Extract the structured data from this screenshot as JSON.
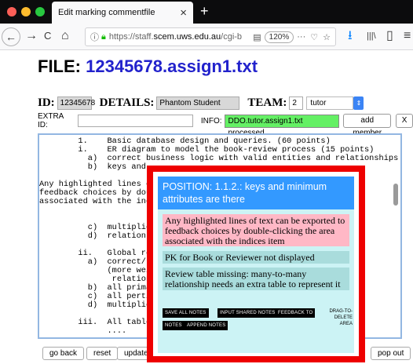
{
  "browser": {
    "tab_title": "Edit marking commentfile",
    "tab_close": "×",
    "new_tab": "+",
    "url_scheme": "https://staff.",
    "url_host": "scem.uws.edu.au",
    "url_rest": "/cgi-b",
    "zoom": "120%",
    "more_icon": "···",
    "nav": {
      "back": "←",
      "forward": "→",
      "reload": "C",
      "home": "⌂"
    },
    "toolbar_icons": [
      "⭳",
      "|||\\",
      "▯",
      "≡"
    ]
  },
  "page": {
    "file_label": "FILE:",
    "file_name": "12345678.assign1.txt",
    "id_label": "ID:",
    "id_value": "12345678",
    "details_label": "DETAILS:",
    "details_value": "Phantom Student",
    "team_label": "TEAM:",
    "team_value": "2",
    "role_select": "tutor",
    "extra_id_label": "EXTRA ID:",
    "info_label": "INFO:",
    "info_value": "DDO.tutor.assign1.txt processed",
    "add_member": "add member",
    "x_button": "X"
  },
  "textarea_lines": [
    "        1.    Basic database design and queries. (60 points)",
    "        i.    ER diagram to model the book-review process (15 points)",
    "          a)  correct business logic with valid entities and relationships",
    "          b)  keys and",
    "",
    "Any highlighted lines of",
    "feedback choices by doubl",
    "associated with the indic",
    "",
    "",
    "          c)  multiplic",
    "          d)  relations",
    "",
    "        ii.   Global re",
    "          a)  correct/r",
    "              (more wei",
    "               relation",
    "          b)  all prima",
    "          c)  all perti",
    "          d)  multiplic",
    "",
    "        iii.  All table",
    "              ...."
  ],
  "bottom_buttons": {
    "go_back": "go back",
    "reset": "reset",
    "update": "update file",
    "pop_out": "pop out"
  },
  "popup": {
    "position_header": "POSITION: 1.1.2.: keys and minimum attributes are there",
    "notes": [
      "Any highlighted lines of text can be exported to feedback choices by double-clicking the area associated with the indices item",
      "PK for Book or Reviewer not displayed",
      "Review table missing: many-to-many relationship needs an extra table to represent it"
    ],
    "buttons": {
      "save_all": "Save All Notes",
      "input_shared": "Input Shared Notes",
      "feedback_to": "Feedback to",
      "notes": "Notes",
      "append": "Append Notes"
    },
    "drag_label": "Drag-to-Delete Area"
  }
}
